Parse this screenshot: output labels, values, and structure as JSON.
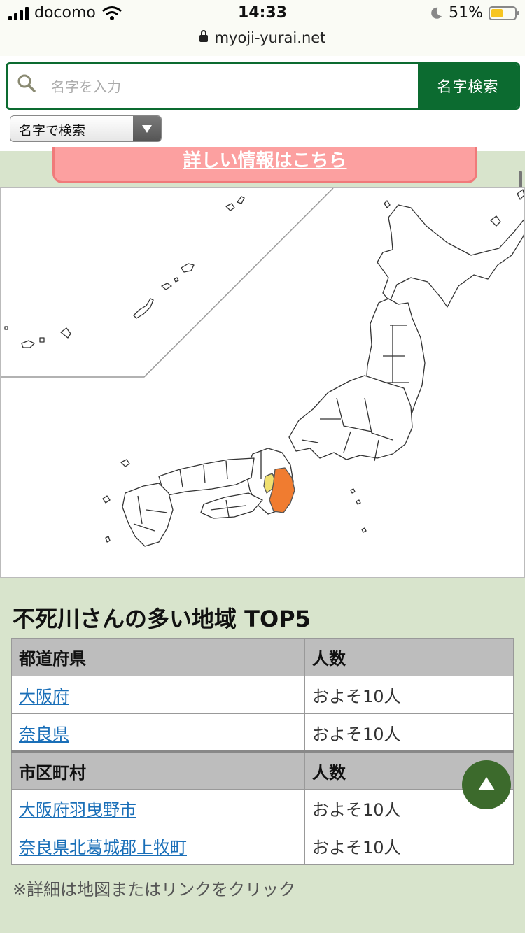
{
  "status_bar": {
    "carrier": "docomo",
    "time": "14:33",
    "battery_percent": "51%",
    "battery_level": 0.51,
    "url": "myoji-yurai.net"
  },
  "search": {
    "placeholder": "名字を入力",
    "button_label": "名字検索",
    "mode_selected": "名字で検索"
  },
  "banner": {
    "link_text": "詳しい情報はこちら",
    "bg_color": "#fca0a0"
  },
  "map": {
    "highlight_colors": {
      "osaka": "#f0e070",
      "nara": "#f07c30"
    }
  },
  "ranking": {
    "title": "不死川さんの多い地域 TOP5",
    "prefecture_header": {
      "name": "都道府県",
      "count": "人数"
    },
    "prefectures": [
      {
        "name": "大阪府",
        "count": "およそ10人"
      },
      {
        "name": "奈良県",
        "count": "およそ10人"
      }
    ],
    "city_header": {
      "name": "市区町村",
      "count": "人数"
    },
    "cities": [
      {
        "name": "大阪府羽曳野市",
        "count": "およそ10人"
      },
      {
        "name": "奈良県北葛城郡上牧町",
        "count": "およそ10人"
      }
    ],
    "note": "※詳細は地図またはリンクをクリック"
  },
  "icons": {
    "search": "search-icon",
    "lock": "lock-icon",
    "back_to_top": "arrow-up-icon"
  }
}
